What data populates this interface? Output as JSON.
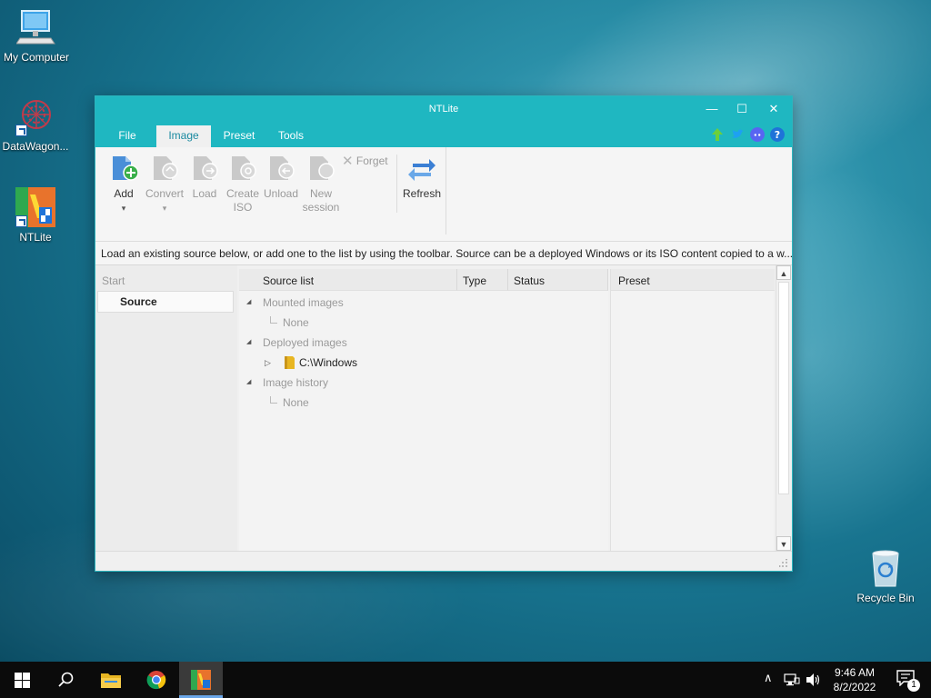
{
  "desktop": {
    "icons": [
      {
        "label": "My Computer"
      },
      {
        "label": "DataWagon..."
      },
      {
        "label": "NTLite"
      },
      {
        "label": "Recycle Bin"
      }
    ]
  },
  "window": {
    "title": "NTLite",
    "controls": {
      "minimize": "—",
      "maximize": "☐",
      "close": "✕"
    },
    "menu": [
      {
        "label": "File",
        "active": false
      },
      {
        "label": "Image",
        "active": true
      },
      {
        "label": "Preset",
        "active": false
      },
      {
        "label": "Tools",
        "active": false
      }
    ],
    "toolbar": {
      "add": "Add",
      "add_dropdown": "▾",
      "convert": "Convert",
      "load": "Load",
      "create_iso_1": "Create",
      "create_iso_2": "ISO",
      "unload": "Unload",
      "new_session_1": "New",
      "new_session_2": "session",
      "forget": "Forget",
      "refresh": "Refresh"
    },
    "info": "Load an existing source below, or add one to the list by using the toolbar. Source can be a deployed Windows or its ISO content copied to a w...",
    "left_nav": {
      "start": "Start",
      "source": "Source"
    },
    "columns": {
      "source_list": "Source list",
      "type": "Type",
      "status": "Status",
      "preset": "Preset"
    },
    "tree": {
      "mounted": "Mounted images",
      "mounted_none": "None",
      "deployed": "Deployed images",
      "windows": "C:\\Windows",
      "history": "Image history",
      "history_none": "None"
    }
  },
  "taskbar": {
    "time": "9:46 AM",
    "date": "8/2/2022",
    "notifications": "1"
  },
  "colors": {
    "accent": "#1fb7c1",
    "taskbar": "#0b0b0b"
  }
}
